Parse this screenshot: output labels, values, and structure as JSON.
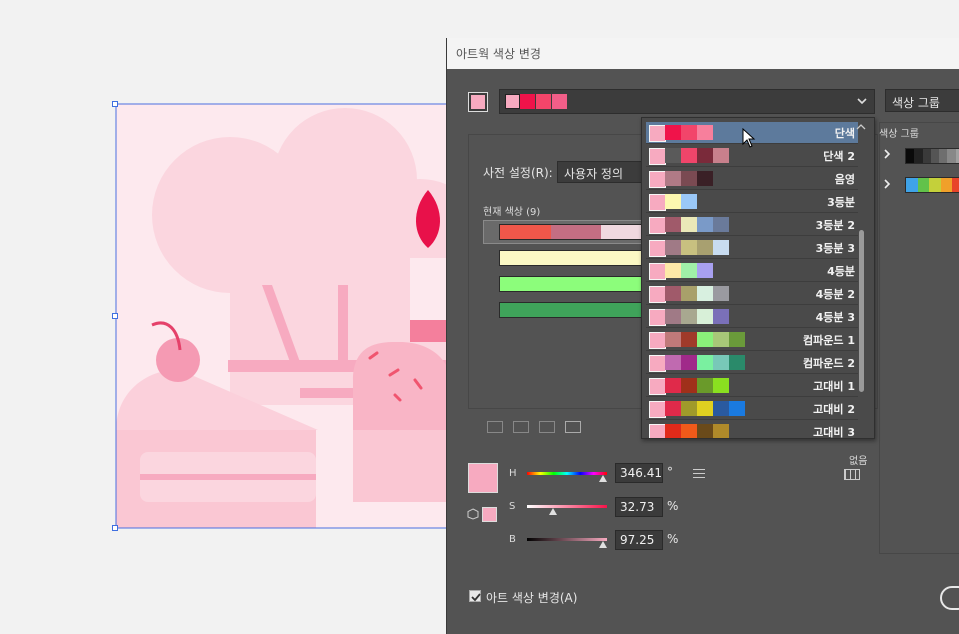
{
  "dialog": {
    "title": "아트웍 색상 변경",
    "color_group_label": "색상 그룹",
    "color_group_header": "색상 그룹",
    "preset_label": "사전 설정(R):",
    "preset_value": "사용자 정의",
    "current_colors_label": "현재 색상 (9)",
    "current_bars": [
      {
        "segments": [
          "#f0574a",
          "#c46e83",
          "#f0d8df"
        ]
      },
      {
        "segments": [
          "#fbf8c4"
        ]
      },
      {
        "segments": [
          "#8cfd7b"
        ]
      },
      {
        "segments": [
          "#3fa35a"
        ]
      }
    ],
    "top_swatches": [
      "#f7aac0",
      "#f0134a",
      "#f4456a",
      "#f25e88"
    ],
    "hsb": {
      "h_label": "H",
      "h_value": "346.41",
      "h_unit": "°",
      "s_label": "S",
      "s_value": "32.73",
      "s_unit": "%",
      "b_label": "B",
      "b_value": "97.25",
      "b_unit": "%"
    },
    "none_label": "없음",
    "recolor_checkbox_label": "아트 색상 변경(A)",
    "recolor_checked": true,
    "current_color": "#f7aac0",
    "group_rows": [
      {
        "colors": [
          "#0a0a0a",
          "#222",
          "#3a3a3a",
          "#555",
          "#6e6e6e",
          "#888",
          "#a0a0a0"
        ]
      },
      {
        "colors": [
          "#3fa3e8",
          "#62c24a",
          "#c4d03a",
          "#f0a02a",
          "#e8442a"
        ]
      }
    ]
  },
  "dropdown": {
    "items": [
      {
        "name": "단색",
        "colors": [
          "#f7aac0",
          "#f0134a",
          "#f2456a",
          "#f77f9c"
        ],
        "selected": true
      },
      {
        "name": "단색 2",
        "colors": [
          "#f7aac0",
          "#5a5a5a",
          "#f0456a",
          "#7a2a3a",
          "#c8808c"
        ]
      },
      {
        "name": "음영",
        "colors": [
          "#f7aac0",
          "#b07a86",
          "#7a4a52",
          "#3a2026"
        ]
      },
      {
        "name": "3등분",
        "colors": [
          "#f7aac0",
          "#fdf8b0",
          "#9ac8f8"
        ]
      },
      {
        "name": "3등분 2",
        "colors": [
          "#f7aac0",
          "#a05a6a",
          "#eae8b8",
          "#7a9ac8",
          "#6a7a9a"
        ]
      },
      {
        "name": "3등분 3",
        "colors": [
          "#f7aac0",
          "#a07a86",
          "#c8c080",
          "#a8a070",
          "#c8dcf0"
        ]
      },
      {
        "name": "4등분",
        "colors": [
          "#f7aac0",
          "#fde8a8",
          "#a0f0a8",
          "#a8a0f0"
        ]
      },
      {
        "name": "4등분 2",
        "colors": [
          "#f7aac0",
          "#a05a6a",
          "#a8a06a",
          "#d8f0e0",
          "#9a9aa0"
        ]
      },
      {
        "name": "4등분 3",
        "colors": [
          "#f7aac0",
          "#a07a86",
          "#a8a890",
          "#d8f0d8",
          "#7a70b8"
        ]
      },
      {
        "name": "컴파운드 1",
        "colors": [
          "#f7aac0",
          "#c07a7a",
          "#a03a2a",
          "#8af07a",
          "#a8c878",
          "#6a9a3a"
        ]
      },
      {
        "name": "컴파운드 2",
        "colors": [
          "#f7aac0",
          "#c06ab0",
          "#a02a8a",
          "#7af0a0",
          "#78c8b8",
          "#2a8a6a"
        ]
      },
      {
        "name": "고대비 1",
        "colors": [
          "#f7aac0",
          "#e02a4a",
          "#a0301a",
          "#6a9a2a",
          "#8ae020"
        ]
      },
      {
        "name": "고대비 2",
        "colors": [
          "#f7aac0",
          "#e02a4a",
          "#a09a2a",
          "#e0d020",
          "#2a5aa0",
          "#1a7ae0"
        ]
      },
      {
        "name": "고대비 3",
        "colors": [
          "#f7aac0",
          "#e02a1a",
          "#f05a1a",
          "#6a4a1a",
          "#b08a2a"
        ]
      }
    ]
  }
}
